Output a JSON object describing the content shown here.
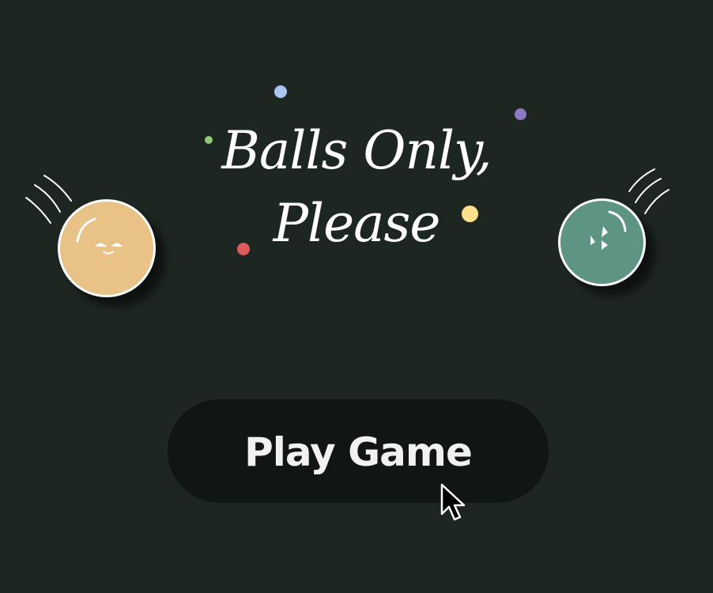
{
  "title": {
    "line1": "Balls Only,",
    "line2": "Please"
  },
  "play_button": {
    "label": "Play Game"
  },
  "colors": {
    "background": "#1e2622",
    "button_bg": "#121613",
    "yellow_ball": "#e8c286",
    "green_ball": "#5e9483",
    "confetti_blue": "#a9c5f3",
    "confetti_purple": "#8c79c3",
    "confetti_green": "#8fc97a",
    "confetti_yellow": "#fde08d",
    "confetti_red": "#de5b5b",
    "confetti_light_blue": "#d2e0fb"
  },
  "icons": {
    "yellow_ball_face": "happy-face-icon",
    "green_ball_face": "cool-face-icon",
    "cursor": "arrow-cursor-icon"
  }
}
